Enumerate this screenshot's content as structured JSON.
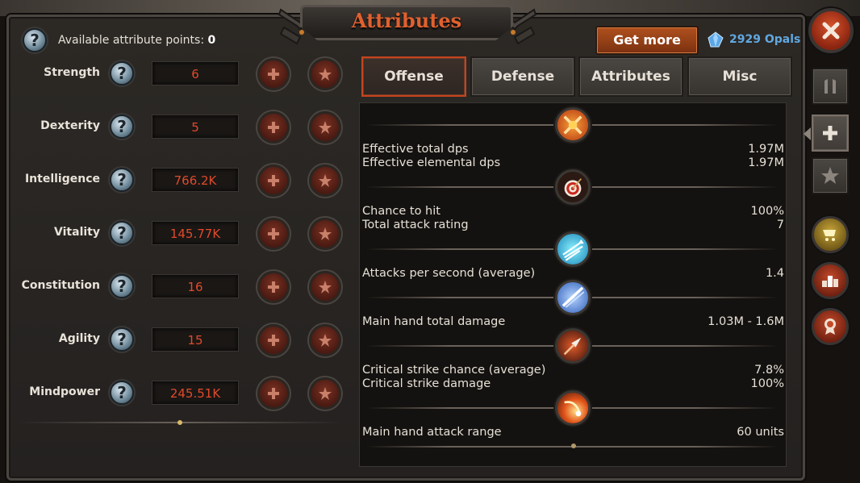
{
  "title": "Attributes",
  "available_points": {
    "label": "Available attribute points:",
    "value": "0"
  },
  "attributes": [
    {
      "label": "Strength",
      "value": "6"
    },
    {
      "label": "Dexterity",
      "value": "5"
    },
    {
      "label": "Intelligence",
      "value": "766.2K"
    },
    {
      "label": "Vitality",
      "value": "145.77K"
    },
    {
      "label": "Constitution",
      "value": "16"
    },
    {
      "label": "Agility",
      "value": "15"
    },
    {
      "label": "Mindpower",
      "value": "245.51K"
    }
  ],
  "get_more_label": "Get more",
  "opals": "2929 Opals",
  "tabs": [
    "Offense",
    "Defense",
    "Attributes",
    "Misc"
  ],
  "active_tab": "Offense",
  "stats": {
    "effective_total_dps": {
      "label": "Effective total dps",
      "value": "1.97M"
    },
    "effective_elemental_dps": {
      "label": "Effective elemental dps",
      "value": "1.97M"
    },
    "chance_to_hit": {
      "label": "Chance to hit",
      "value": "100%"
    },
    "total_attack_rating": {
      "label": "Total attack rating",
      "value": "7"
    },
    "attacks_per_second": {
      "label": "Attacks per second (average)",
      "value": "1.4"
    },
    "main_hand_total_damage": {
      "label": "Main hand total damage",
      "value": "1.03M - 1.6M"
    },
    "critical_strike_chance": {
      "label": "Critical strike chance (average)",
      "value": "7.8%"
    },
    "critical_strike_damage": {
      "label": "Critical strike damage",
      "value": "100%"
    },
    "main_hand_attack_range": {
      "label": "Main hand attack range",
      "value": "60 units"
    }
  },
  "colors": {
    "accent": "#e0602e",
    "value_red": "#e04a2a",
    "opal_blue": "#61a8e0"
  },
  "icons": {
    "section_1": "crossed-swords-icon",
    "section_2": "target-icon",
    "section_3": "arrows-speed-icon",
    "section_4": "blade-slash-icon",
    "section_5": "arrowhead-icon",
    "section_6": "critical-burst-icon",
    "sidebar": [
      "character-icon",
      "plus-icon",
      "star-icon",
      "shop-cart-icon",
      "ranking-podium-icon",
      "award-ribbon-icon"
    ]
  }
}
